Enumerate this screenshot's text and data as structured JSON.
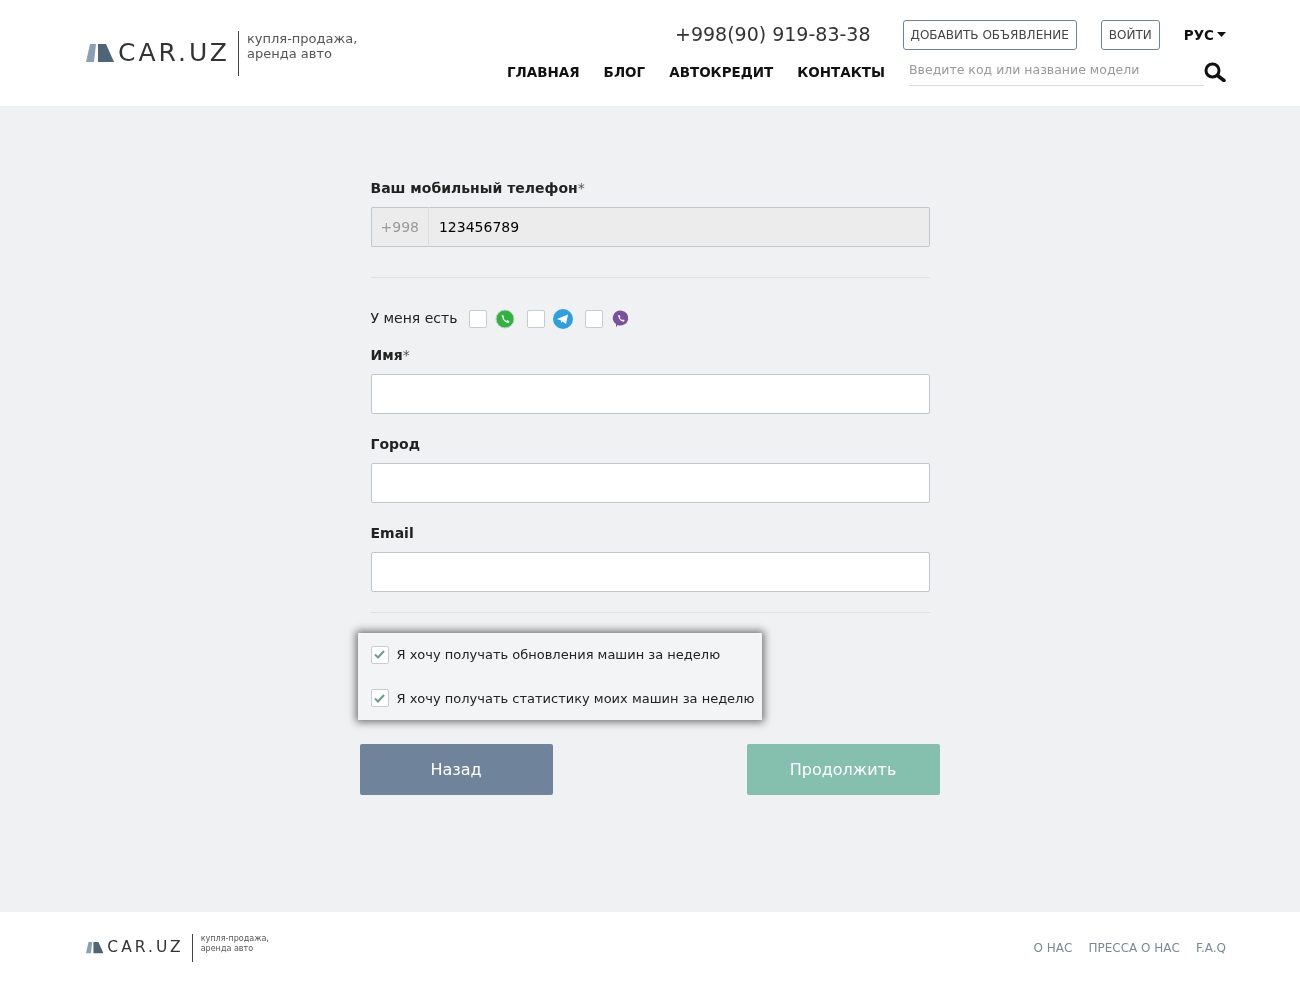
{
  "header": {
    "logo": {
      "name": "CAR.UZ",
      "tagline": [
        "купля-продажа,",
        "аренда авто"
      ]
    },
    "phone": "+998(90) 919-83-38",
    "add_button": "ДОБАВИТЬ ОБЪЯВЛЕНИЕ",
    "login_button": "ВОЙТИ",
    "language": "РУС",
    "nav": [
      "ГЛАВНАЯ",
      "БЛОГ",
      "АВТОКРЕДИТ",
      "КОНТАКТЫ"
    ],
    "search": {
      "placeholder": "Введите код или название модели"
    }
  },
  "form": {
    "phone": {
      "label": "Ваш мобильный телефон",
      "required_mark": "*",
      "prefix": "+998",
      "value": "123456789"
    },
    "messengers": {
      "label": "У меня есть",
      "items": [
        {
          "kind": "whatsapp",
          "checked": false
        },
        {
          "kind": "telegram",
          "checked": false
        },
        {
          "kind": "viber",
          "checked": false
        }
      ]
    },
    "fields": [
      {
        "label": "Имя",
        "required_mark": "*"
      },
      {
        "label": "Город"
      },
      {
        "label": "Email"
      }
    ],
    "subscriptions": [
      {
        "label": "Я хочу получать обновления машин за неделю",
        "checked": true
      },
      {
        "label": "Я хочу получать статистику моих машин за неделю",
        "checked": true
      }
    ],
    "back_button": "Назад",
    "continue_button": "Продолжить"
  },
  "footer": {
    "logo": {
      "name": "CAR.UZ",
      "tagline": [
        "купля-продажа,",
        "аренда авто"
      ]
    },
    "links": [
      "О НАС",
      "ПРЕССА О НАС",
      "F.A.Q"
    ]
  }
}
